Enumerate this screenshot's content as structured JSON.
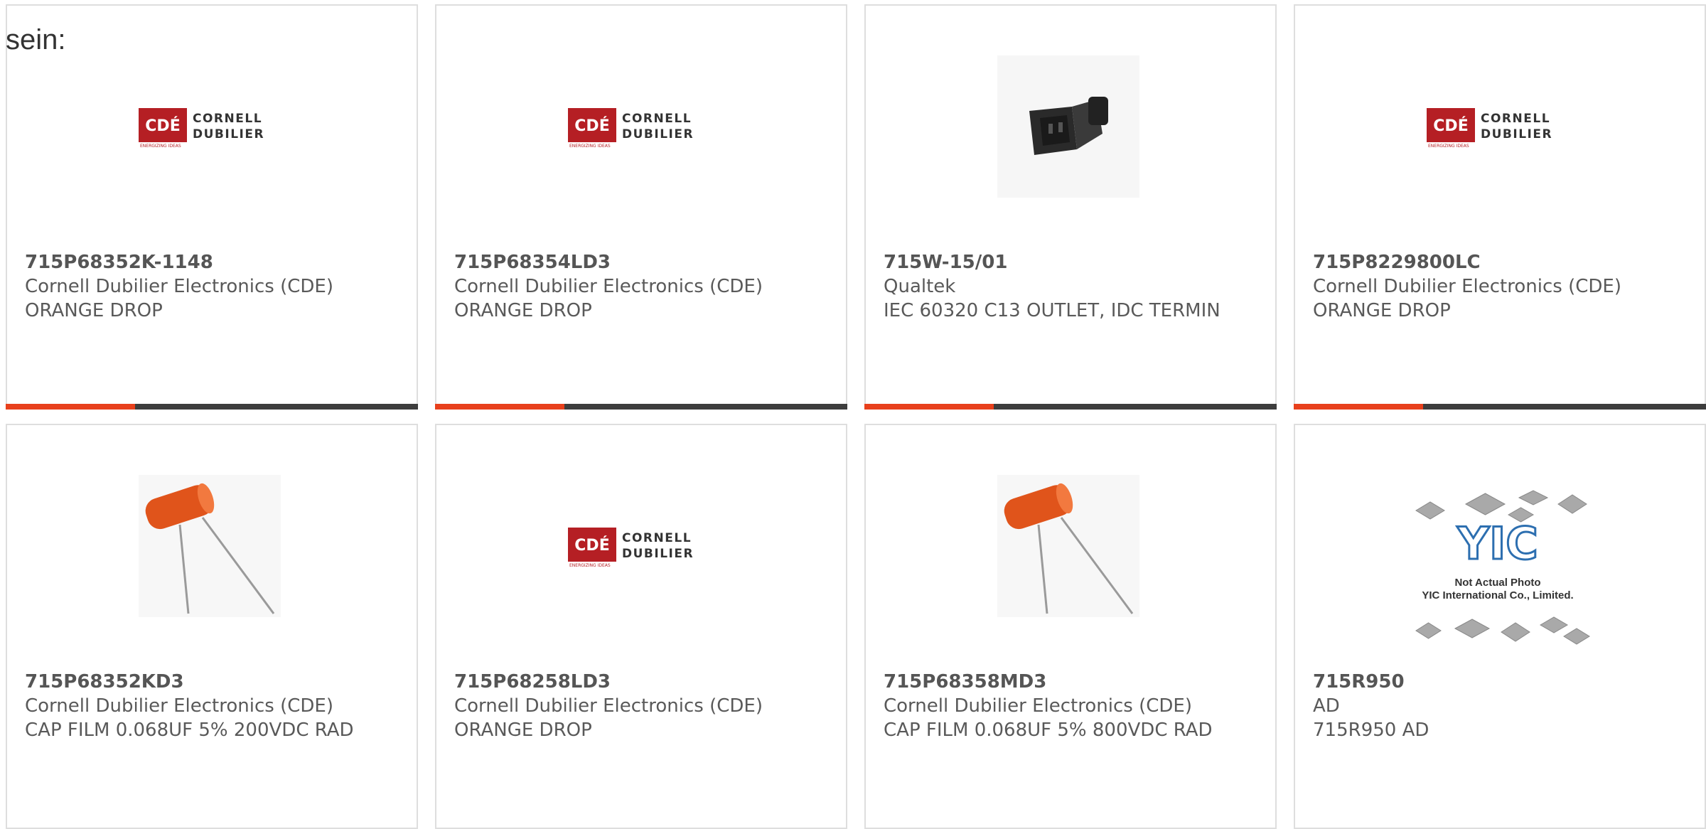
{
  "intro_text": "sein:",
  "accent_color": "#e8401c",
  "products": [
    {
      "part": "715P68352K-1148",
      "manufacturer": "Cornell Dubilier Electronics (CDE)",
      "description": "ORANGE DROP",
      "image": "cde-logo",
      "accent_bar": true
    },
    {
      "part": "715P68354LD3",
      "manufacturer": "Cornell Dubilier Electronics (CDE)",
      "description": "ORANGE DROP",
      "image": "cde-logo",
      "accent_bar": true
    },
    {
      "part": "715W-15/01",
      "manufacturer": "Qualtek",
      "description": "IEC 60320 C13 OUTLET, IDC TERMIN",
      "image": "iec-outlet-photo",
      "accent_bar": true
    },
    {
      "part": "715P8229800LC",
      "manufacturer": "Cornell Dubilier Electronics (CDE)",
      "description": "ORANGE DROP",
      "image": "cde-logo",
      "accent_bar": true
    },
    {
      "part": "715P68352KD3",
      "manufacturer": "Cornell Dubilier Electronics (CDE)",
      "description": "CAP FILM 0.068UF 5% 200VDC RAD",
      "image": "orange-capacitor-photo",
      "accent_bar": false
    },
    {
      "part": "715P68258LD3",
      "manufacturer": "Cornell Dubilier Electronics (CDE)",
      "description": "ORANGE DROP",
      "image": "cde-logo",
      "accent_bar": false
    },
    {
      "part": "715P68358MD3",
      "manufacturer": "Cornell Dubilier Electronics (CDE)",
      "description": "CAP FILM 0.068UF 5% 800VDC RAD",
      "image": "orange-capacitor-photo",
      "accent_bar": false
    },
    {
      "part": "715R950",
      "manufacturer": "AD",
      "description": "715R950 AD",
      "image": "yic-placeholder",
      "accent_bar": false
    }
  ],
  "logo_text": {
    "cde": "CDÉ",
    "cornell": "CORNELL",
    "dubilier": "DUBILIER",
    "tagline": "ENERGIZING IDEAS"
  },
  "yic_text": {
    "mark": "YIC",
    "line1": "Not Actual Photo",
    "line2": "YIC International Co., Limited."
  }
}
